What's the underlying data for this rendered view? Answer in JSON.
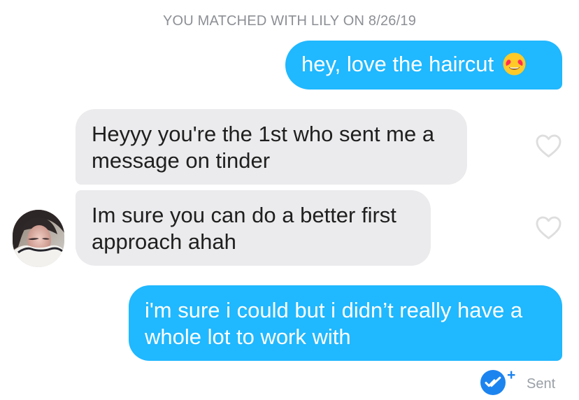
{
  "conversation": {
    "match_banner": "YOU MATCHED WITH LILY ON 8/26/19",
    "messages": [
      {
        "sender": "self",
        "text": "hey, love the haircut",
        "emoji": "😍"
      },
      {
        "sender": "match",
        "text": "Heyyy you're the 1st who sent me a message on tinder"
      },
      {
        "sender": "match",
        "text": "Im sure you can do a better first approach ahah"
      },
      {
        "sender": "self",
        "text": "i'm sure i could but i didn’t really have a whole lot to work with"
      }
    ],
    "status": {
      "label": "Sent",
      "extra": "+"
    }
  },
  "colors": {
    "sent_bubble": "#20b8ff",
    "received_bubble": "#ebebed",
    "meta_text": "#8c8f94",
    "sent_check": "#1c84ef"
  },
  "icons": {
    "emoji": "heart-eyes-emoji-icon",
    "like": "heart-outline-icon",
    "status": "double-check-icon",
    "avatar": "profile-avatar"
  }
}
